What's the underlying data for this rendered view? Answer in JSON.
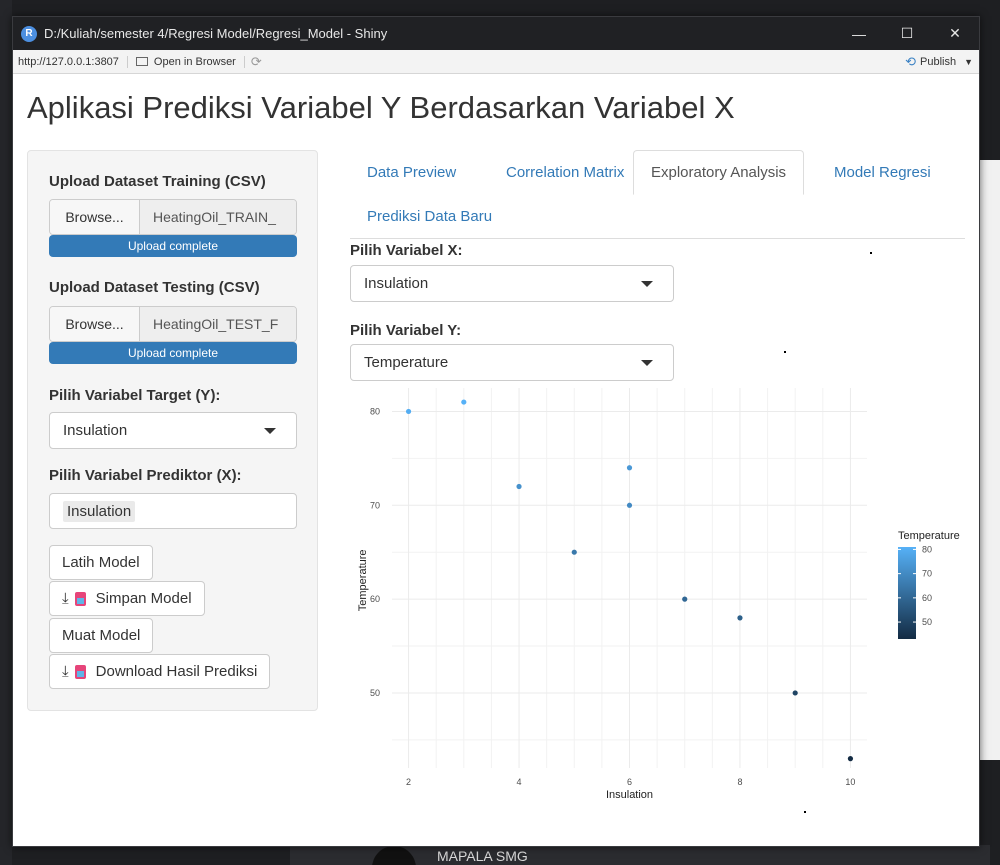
{
  "window": {
    "title": "D:/Kuliah/semester 4/Regresi Model/Regresi_Model - Shiny",
    "icon_label": "R",
    "minimize": "—",
    "maximize": "☐",
    "close": "✕"
  },
  "toolbar": {
    "url": "http://127.0.0.1:3807",
    "open_in_browser": "Open in Browser",
    "publish": "Publish"
  },
  "app": {
    "title": "Aplikasi Prediksi Variabel Y Berdasarkan Variabel X"
  },
  "sidebar": {
    "train_label": "Upload Dataset Training (CSV)",
    "train_browse": "Browse...",
    "train_file": "HeatingOil_TRAIN_",
    "train_progress": "Upload complete",
    "test_label": "Upload Dataset Testing (CSV)",
    "test_browse": "Browse...",
    "test_file": "HeatingOil_TEST_F",
    "test_progress": "Upload complete",
    "target_label": "Pilih Variabel Target (Y):",
    "target_value": "Insulation",
    "predictor_label": "Pilih Variabel Prediktor (X):",
    "predictor_value": "Insulation",
    "btn_train": "Latih Model",
    "btn_save": "Simpan Model",
    "btn_load": "Muat Model",
    "btn_download": "Download Hasil Prediksi"
  },
  "tabs": [
    {
      "label": "Data Preview"
    },
    {
      "label": "Correlation Matrix"
    },
    {
      "label": "Exploratory Analysis"
    },
    {
      "label": "Model Regresi"
    },
    {
      "label": "Prediksi Data Baru"
    }
  ],
  "main": {
    "x_label": "Pilih Variabel X:",
    "x_value": "Insulation",
    "y_label": "Pilih Variabel Y:",
    "y_value": "Temperature"
  },
  "background": {
    "bottom_text": "MAPALA SMG"
  },
  "colors": {
    "accent": "#337ab7",
    "gradient_low": "#132b43",
    "gradient_high": "#56b1f7"
  },
  "chart_data": {
    "type": "scatter",
    "xlabel": "Insulation",
    "ylabel": "Temperature",
    "xlim": [
      1.7,
      10.3
    ],
    "ylim": [
      42,
      82.5
    ],
    "xticks": [
      2,
      4,
      6,
      8,
      10
    ],
    "yticks": [
      50,
      60,
      70,
      80
    ],
    "grid": true,
    "legend": {
      "title": "Temperature",
      "ticks": [
        80,
        70,
        60,
        50
      ],
      "placement": "right",
      "range": [
        43,
        81
      ]
    },
    "points": [
      {
        "x": 2,
        "y": 80
      },
      {
        "x": 3,
        "y": 81
      },
      {
        "x": 4,
        "y": 72
      },
      {
        "x": 5,
        "y": 65
      },
      {
        "x": 6,
        "y": 74
      },
      {
        "x": 6,
        "y": 70
      },
      {
        "x": 7,
        "y": 60
      },
      {
        "x": 8,
        "y": 58
      },
      {
        "x": 9,
        "y": 50
      },
      {
        "x": 10,
        "y": 43
      }
    ]
  }
}
